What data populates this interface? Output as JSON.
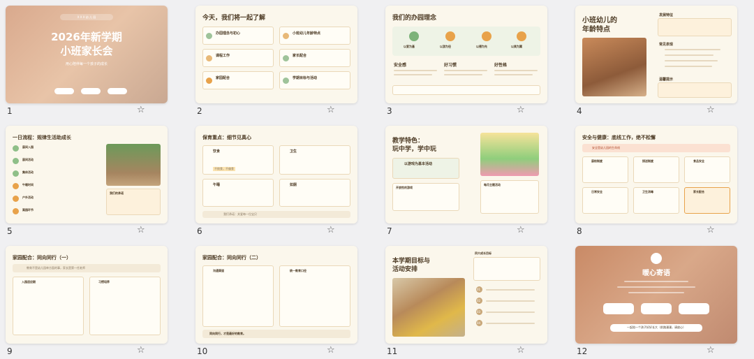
{
  "slides": [
    {
      "number": "1",
      "title": "2026年新学期",
      "subtitle": "小班家长会",
      "badge": "X X X 幼 儿 园",
      "tagline": "用心陪伴每一个孩子的成长",
      "buttons": [
        "",
        "",
        ""
      ]
    },
    {
      "number": "2",
      "title": "今天，我们将一起了解",
      "items": [
        "办园理念与初心",
        "小班幼儿年龄特点",
        "课程工作",
        "家长配合",
        "家园配合",
        "学期目标与活动"
      ],
      "codes": [
        "01",
        "02",
        "03",
        "04",
        "05",
        "06"
      ]
    },
    {
      "number": "3",
      "title": "我们的办园理念",
      "badges": [
        "以爱为基",
        "以游为径",
        "以德为先",
        "以美为翼"
      ],
      "sections": [
        "安全感",
        "好习惯",
        "好性格"
      ]
    },
    {
      "number": "4",
      "title": "小班幼儿的",
      "title2": "年龄特点",
      "sections": [
        "发展特征",
        "常见表现",
        "温馨提示"
      ]
    },
    {
      "number": "5",
      "title": "一日流程：规律生活助成长",
      "items": [
        "晨间入园",
        "晨间活动",
        "集体活动",
        "午睡时间",
        "户外活动",
        "离园环节"
      ],
      "photo_caption": "我们的承诺"
    },
    {
      "number": "6",
      "title": "保育重点：细节见真心",
      "items": [
        "饮食",
        "卫生",
        "午睡",
        "如厕"
      ],
      "highlight": "不挑食，不偏食",
      "footer": "我们承诺：关爱每一位宝贝"
    },
    {
      "number": "7",
      "title": "教学特色：",
      "title2": "玩中学，学中玩",
      "banner": "以游戏为基本活动",
      "list_title": "开放性的游戏",
      "side_title": "每月主题活动"
    },
    {
      "number": "8",
      "title": "安全与健康：底线工作，绝不松懈",
      "notice": "安全是幼儿园的生命线",
      "items": [
        "晨检制度",
        "接送制度",
        "食品安全",
        "日常安全",
        "卫生消毒",
        "家长配合"
      ]
    },
    {
      "number": "9",
      "title": "家园配合：同向同行（一）",
      "banner": "教育不是幼儿园单方面的事，家长是第一任老师",
      "columns": [
        "入园适应期",
        "习惯培养"
      ]
    },
    {
      "number": "10",
      "title": "家园配合：同向同行（二）",
      "columns": [
        "沟通渠道",
        "统一教育口径"
      ],
      "footer": "同向同行，才是最好的教育。"
    },
    {
      "number": "11",
      "title": "本学期目标与",
      "title2": "活动安排",
      "side_title": "四大成长目标",
      "codes": [
        "01",
        "02",
        "03",
        "04"
      ]
    },
    {
      "number": "12",
      "title": "暖心寄语",
      "buttons": [
        "",
        "",
        ""
      ],
      "footer": "一起陪一个孩子好好长大（前路漫漫，请放心）"
    }
  ],
  "colors": {
    "accent": "#e8a24a",
    "green": "#6fa56a",
    "cream": "#fbf7ec",
    "brown": "#4d3b25"
  },
  "icons": {
    "star": "star-icon"
  },
  "star_glyph": "☆"
}
